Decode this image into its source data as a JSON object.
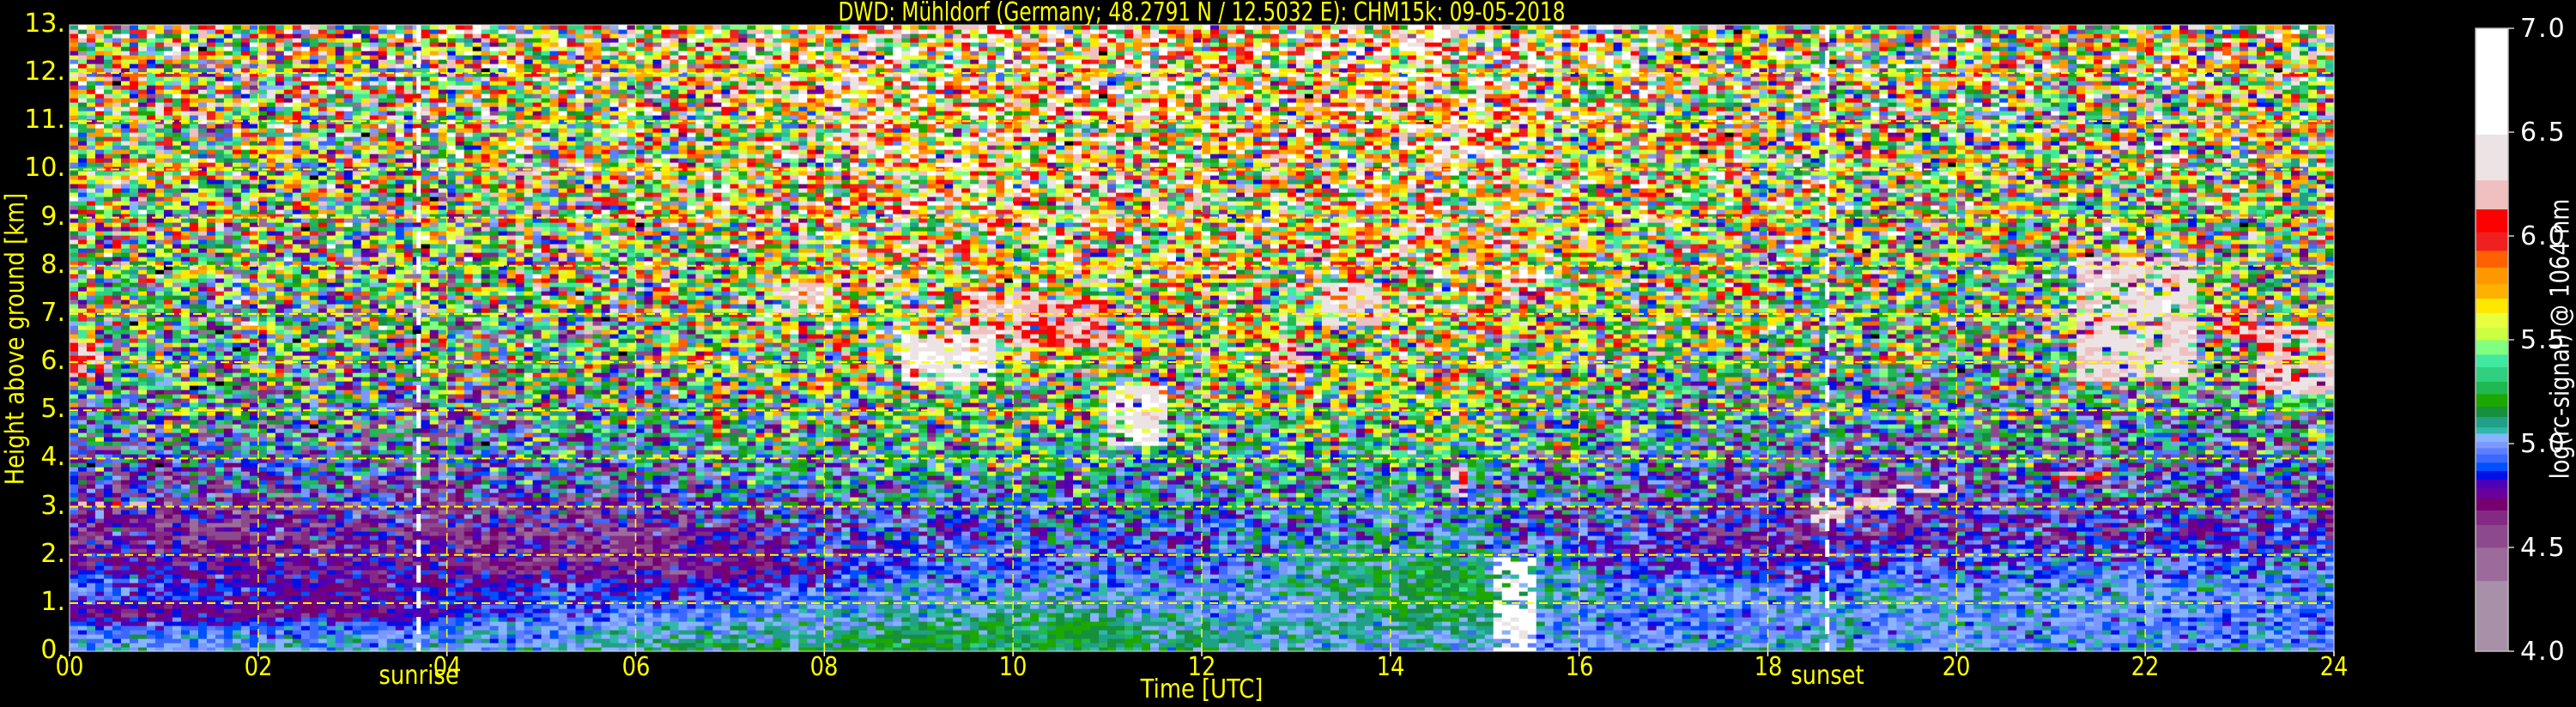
{
  "chart_data": {
    "type": "heatmap",
    "title": "DWD: Mühldorf (Germany; 48.2791 N / 12.5032 E):    CHM15k: 09-05-2018",
    "xlabel": "Time [UTC]",
    "ylabel": "Height above ground [km]",
    "xlim": [
      0,
      24
    ],
    "ylim": [
      0,
      13
    ],
    "xticks": [
      0,
      2,
      4,
      6,
      8,
      10,
      12,
      14,
      16,
      18,
      20,
      22,
      24
    ],
    "xtick_labels": [
      "00",
      "02",
      "04",
      "06",
      "08",
      "10",
      "12",
      "14",
      "16",
      "18",
      "20",
      "22",
      "24"
    ],
    "yticks": [
      0,
      1,
      2,
      3,
      4,
      5,
      6,
      7,
      8,
      9,
      10,
      11,
      12,
      13
    ],
    "ytick_labels": [
      "0.",
      "1.",
      "2.",
      "3.",
      "4.",
      "5.",
      "6.",
      "7.",
      "8.",
      "9.",
      "10.",
      "11.",
      "12.",
      "13."
    ],
    "grid": true,
    "grid_color": "#ffff00",
    "annotations": [
      {
        "label": "sunrise",
        "time": 3.7
      },
      {
        "label": "sunset",
        "time": 18.63
      }
    ],
    "colorbar": {
      "label": "log(rc-signal) @ 1064 nm",
      "range": [
        4.0,
        7.0
      ],
      "ticks": [
        4.0,
        4.5,
        5.0,
        5.5,
        6.0,
        6.5,
        7.0
      ],
      "tick_labels": [
        "4.0",
        "4.5",
        "5.0",
        "5.5",
        "6.0",
        "6.5",
        "7.0"
      ],
      "under_color": "#000000",
      "levels": [
        [
          4.0,
          "#a891a8"
        ],
        [
          4.34,
          "#9c6b9c"
        ],
        [
          4.5,
          "#8c4a8c"
        ],
        [
          4.61,
          "#842a84"
        ],
        [
          4.68,
          "#760070"
        ],
        [
          4.74,
          "#6800a0"
        ],
        [
          4.79,
          "#4c00b8"
        ],
        [
          4.83,
          "#0010e8"
        ],
        [
          4.87,
          "#0050ff"
        ],
        [
          4.91,
          "#3c68ff"
        ],
        [
          4.95,
          "#5c80ff"
        ],
        [
          4.98,
          "#7c98ff"
        ],
        [
          5.01,
          "#88b4ff"
        ],
        [
          5.05,
          "#30b8a8"
        ],
        [
          5.08,
          "#20a088"
        ],
        [
          5.13,
          "#16903c"
        ],
        [
          5.18,
          "#1ca800"
        ],
        [
          5.24,
          "#20b850"
        ],
        [
          5.3,
          "#30d080"
        ],
        [
          5.37,
          "#40e8a0"
        ],
        [
          5.43,
          "#80ff80"
        ],
        [
          5.5,
          "#ccff40"
        ],
        [
          5.56,
          "#e8ff40"
        ],
        [
          5.63,
          "#ffe800"
        ],
        [
          5.7,
          "#ffb000"
        ],
        [
          5.77,
          "#ff9800"
        ],
        [
          5.85,
          "#ff6000"
        ],
        [
          5.93,
          "#f02020"
        ],
        [
          6.02,
          "#ff0000"
        ],
        [
          6.13,
          "#f0c0c0"
        ],
        [
          6.27,
          "#ece4e4"
        ],
        [
          6.49,
          "#ffffff"
        ]
      ]
    },
    "grid_heights_km": [
      0.15,
      0.45,
      0.8,
      1.25,
      1.75,
      2.5,
      3.5,
      4.5,
      6,
      8,
      10.5,
      12.5
    ],
    "grid_times_h": [
      0.5,
      1.5,
      2.5,
      3.5,
      4.5,
      5.5,
      6.5,
      7.5,
      8.5,
      9.5,
      10.5,
      11.5,
      12.5,
      13.5,
      14.5,
      15.5,
      16.5,
      17.5,
      18.5,
      19.5,
      20.5,
      21.5,
      22.5,
      23.5
    ],
    "noise_sd": [
      0.08,
      0.07,
      0.07,
      0.08,
      0.1,
      0.15,
      0.25,
      0.35,
      0.45,
      0.5,
      0.55,
      0.6
    ],
    "values": [
      [
        5.0,
        5.0,
        5.0,
        5.0,
        5.0,
        5.05,
        5.15,
        5.15,
        5.15,
        5.2,
        5.2,
        5.1,
        5.05,
        5.05,
        5.05,
        5.0,
        5.0,
        5.0,
        5.05,
        5.0,
        5.0,
        5.0,
        5.0,
        5.0
      ],
      [
        4.95,
        4.95,
        4.95,
        4.95,
        5.0,
        5.0,
        5.05,
        5.05,
        5.1,
        5.15,
        5.2,
        5.1,
        5.05,
        5.05,
        5.1,
        5.0,
        4.95,
        4.95,
        5.0,
        5.0,
        5.0,
        5.0,
        4.95,
        4.95
      ],
      [
        4.7,
        4.7,
        4.7,
        4.75,
        4.9,
        4.95,
        4.95,
        5.0,
        5.0,
        5.05,
        5.1,
        5.05,
        5.0,
        5.05,
        5.2,
        5.05,
        4.95,
        4.95,
        5.0,
        5.0,
        5.0,
        5.0,
        4.95,
        4.95
      ],
      [
        4.95,
        4.85,
        4.8,
        4.8,
        4.85,
        4.85,
        4.85,
        4.9,
        5.0,
        5.0,
        5.0,
        5.0,
        5.0,
        5.1,
        5.2,
        5.1,
        5.0,
        5.0,
        4.95,
        5.0,
        5.0,
        5.0,
        5.0,
        5.0
      ],
      [
        4.75,
        4.75,
        4.75,
        4.75,
        4.7,
        4.7,
        4.7,
        4.75,
        4.9,
        4.95,
        4.95,
        4.95,
        5.0,
        5.15,
        5.2,
        5.05,
        4.9,
        4.85,
        4.85,
        4.9,
        4.95,
        4.95,
        4.95,
        4.95
      ],
      [
        4.65,
        4.65,
        4.7,
        4.7,
        4.65,
        4.65,
        4.7,
        4.8,
        4.85,
        4.9,
        4.9,
        4.9,
        4.95,
        5.0,
        5.05,
        4.9,
        4.8,
        4.75,
        4.7,
        4.75,
        4.8,
        4.8,
        4.8,
        4.8
      ],
      [
        4.8,
        4.8,
        4.8,
        4.8,
        4.8,
        4.85,
        4.9,
        5.0,
        5.05,
        5.05,
        5.05,
        5.05,
        5.05,
        5.1,
        5.1,
        5.0,
        4.9,
        4.85,
        4.8,
        4.8,
        4.85,
        4.85,
        4.85,
        4.85
      ],
      [
        4.95,
        4.95,
        4.95,
        4.95,
        5.0,
        5.05,
        5.1,
        5.2,
        5.2,
        5.25,
        5.2,
        5.2,
        5.2,
        5.25,
        5.3,
        5.2,
        5.05,
        5.0,
        4.95,
        4.95,
        5.0,
        5.0,
        5.0,
        5.0
      ],
      [
        5.2,
        5.15,
        5.15,
        5.15,
        5.2,
        5.25,
        5.3,
        5.4,
        5.45,
        5.45,
        5.4,
        5.4,
        5.4,
        5.45,
        5.5,
        5.4,
        5.3,
        5.25,
        5.2,
        5.2,
        5.2,
        5.2,
        5.2,
        5.2
      ],
      [
        5.35,
        5.3,
        5.3,
        5.3,
        5.35,
        5.4,
        5.5,
        5.6,
        5.7,
        5.7,
        5.65,
        5.65,
        5.6,
        5.7,
        5.8,
        5.65,
        5.5,
        5.45,
        5.4,
        5.35,
        5.35,
        5.35,
        5.35,
        5.35
      ],
      [
        5.5,
        5.45,
        5.45,
        5.45,
        5.5,
        5.55,
        5.6,
        5.7,
        5.85,
        5.9,
        5.8,
        5.8,
        5.7,
        5.85,
        5.95,
        5.8,
        5.65,
        5.55,
        5.5,
        5.5,
        5.5,
        5.5,
        5.5,
        5.5
      ],
      [
        5.6,
        5.55,
        5.55,
        5.55,
        5.6,
        5.6,
        5.65,
        5.75,
        5.9,
        5.95,
        5.85,
        5.85,
        5.75,
        5.9,
        6.0,
        5.85,
        5.7,
        5.6,
        5.55,
        5.55,
        5.55,
        5.55,
        5.55,
        5.55
      ]
    ],
    "clouds": [
      {
        "t": [
          0.0,
          0.35
        ],
        "h": [
          5.7,
          6.5
        ],
        "value": 6.3
      },
      {
        "t": [
          0.1,
          0.8
        ],
        "h": [
          3.05,
          3.12
        ],
        "value": 6.4
      },
      {
        "t": [
          6.8,
          6.9
        ],
        "h": [
          4.4,
          5.6
        ],
        "value": 6.1
      },
      {
        "t": [
          7.5,
          8.0
        ],
        "h": [
          7.0,
          7.7
        ],
        "value": 6.5
      },
      {
        "t": [
          8.8,
          9.8
        ],
        "h": [
          5.6,
          6.6
        ],
        "value": 6.6
      },
      {
        "t": [
          9.5,
          10.3
        ],
        "h": [
          6.3,
          7.5
        ],
        "value": 6.4
      },
      {
        "t": [
          10.3,
          11.0
        ],
        "h": [
          6.3,
          7.3
        ],
        "value": 6.3
      },
      {
        "t": [
          11.0,
          11.6
        ],
        "h": [
          4.3,
          5.5
        ],
        "value": 6.6
      },
      {
        "t": [
          12.7,
          13.1
        ],
        "h": [
          5.8,
          6.6
        ],
        "value": 6.3
      },
      {
        "t": [
          13.3,
          13.9
        ],
        "h": [
          6.8,
          7.7
        ],
        "value": 6.5
      },
      {
        "t": [
          14.6,
          14.8
        ],
        "h": [
          3.2,
          3.8
        ],
        "value": 6.3
      },
      {
        "t": [
          15.05,
          15.5
        ],
        "h": [
          0.0,
          2.0
        ],
        "value": 6.8
      },
      {
        "t": [
          15.4,
          15.7
        ],
        "h": [
          7.75,
          7.9
        ],
        "value": 6.8
      },
      {
        "t": [
          18.5,
          18.8
        ],
        "h": [
          2.7,
          3.2
        ],
        "value": 6.5
      },
      {
        "t": [
          18.9,
          19.4
        ],
        "h": [
          2.9,
          3.2
        ],
        "value": 6.5
      },
      {
        "t": [
          19.4,
          19.9
        ],
        "h": [
          3.3,
          3.5
        ],
        "value": 6.5
      },
      {
        "t": [
          21.0,
          21.5
        ],
        "h": [
          3.6,
          3.75
        ],
        "value": 6.3
      },
      {
        "t": [
          21.3,
          22.5
        ],
        "h": [
          5.6,
          8.2
        ],
        "value": 6.5
      },
      {
        "t": [
          22.7,
          23.2
        ],
        "h": [
          6.5,
          7.2
        ],
        "value": 6.3
      },
      {
        "t": [
          23.2,
          24.0
        ],
        "h": [
          5.3,
          6.8
        ],
        "value": 6.4
      }
    ]
  }
}
